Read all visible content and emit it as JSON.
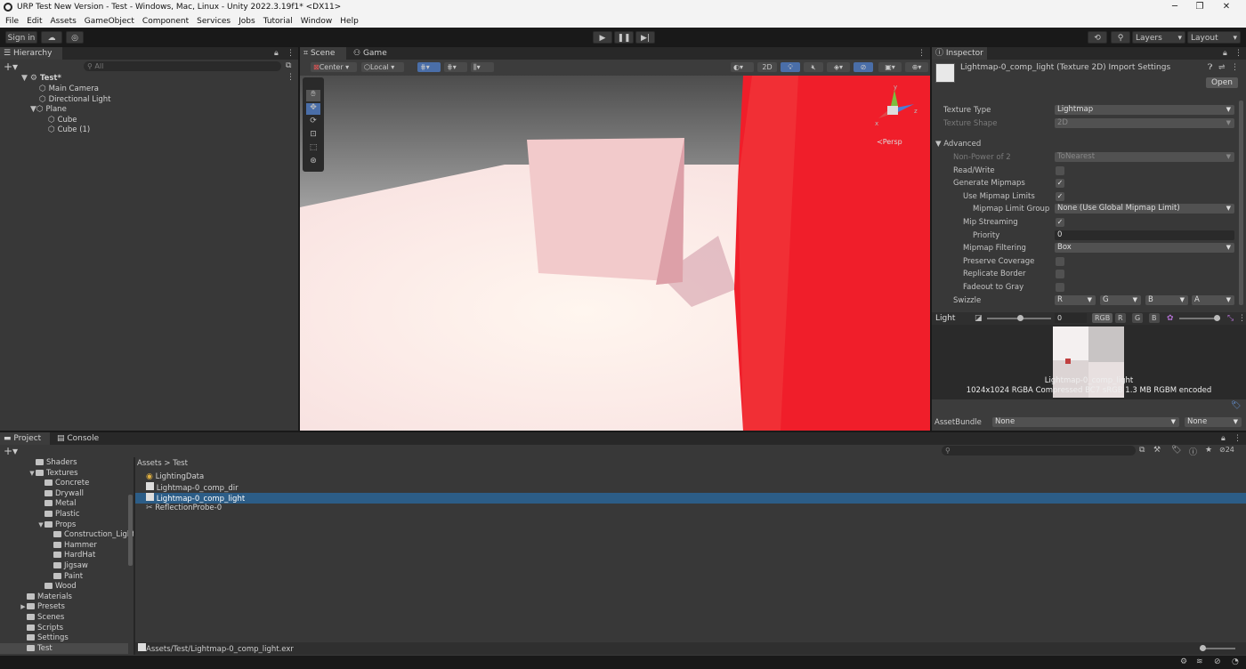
{
  "window": {
    "title": "URP Test New Version - Test - Windows, Mac, Linux - Unity 2022.3.19f1* <DX11>",
    "minimize": "─",
    "maximize": "❐",
    "close": "✕"
  },
  "menu": [
    "File",
    "Edit",
    "Assets",
    "GameObject",
    "Component",
    "Services",
    "Jobs",
    "Tutorial",
    "Window",
    "Help"
  ],
  "toolbar": {
    "sign_in": "Sign in",
    "layers": "Layers",
    "layout": "Layout"
  },
  "hierarchy": {
    "title": "Hierarchy",
    "search_placeholder": "All",
    "scene": "Test*",
    "items": [
      "Main Camera",
      "Directional Light",
      "Plane",
      "Cube",
      "Cube (1)"
    ]
  },
  "scene_view": {
    "tab_scene": "Scene",
    "tab_game": "Game",
    "pivot": "Center",
    "space": "Local",
    "mode_2d": "2D",
    "persp_label": "≺Persp",
    "axis_y": "y",
    "axis_x": "x",
    "axis_z": "z"
  },
  "inspector": {
    "title": "Inspector",
    "asset_title": "Lightmap-0_comp_light (Texture 2D) Import Settings",
    "open_button": "Open",
    "fields": [
      {
        "label": "Texture Type",
        "value": "Lightmap",
        "kind": "dropdown"
      },
      {
        "label": "Texture Shape",
        "value": "2D",
        "kind": "dropdown",
        "dim": true
      }
    ],
    "advanced_label": "Advanced",
    "advanced": [
      {
        "label": "Non-Power of 2",
        "value": "ToNearest",
        "kind": "dropdown",
        "dim": true
      },
      {
        "label": "Read/Write",
        "kind": "check",
        "checked": false
      },
      {
        "label": "Generate Mipmaps",
        "kind": "check",
        "checked": true
      },
      {
        "label": "Use Mipmap Limits",
        "kind": "check",
        "checked": true
      },
      {
        "label": "Mipmap Limit Group",
        "value": "None (Use Global Mipmap Limit)",
        "kind": "dropdown"
      },
      {
        "label": "Mip Streaming",
        "kind": "check",
        "checked": true
      },
      {
        "label": "Priority",
        "value": "0",
        "kind": "text"
      },
      {
        "label": "Mipmap Filtering",
        "value": "Box",
        "kind": "dropdown"
      },
      {
        "label": "Preserve Coverage",
        "kind": "check",
        "checked": false
      },
      {
        "label": "Replicate Border",
        "kind": "check",
        "checked": false
      },
      {
        "label": "Fadeout to Gray",
        "kind": "check",
        "checked": false
      }
    ],
    "swizzle_label": "Swizzle",
    "swizzle": [
      "R",
      "G",
      "B",
      "A"
    ],
    "preview": {
      "title": "Light",
      "mip_value": "0",
      "channels": [
        "RGB",
        "R",
        "G",
        "B"
      ],
      "name": "Lightmap-0_comp_light",
      "info": "1024x1024  RGBA Compressed BC7 sRGB  1.3 MB  RGBM encoded"
    },
    "assetbundle_label": "AssetBundle",
    "assetbundle_name": "None",
    "assetbundle_variant": "None"
  },
  "project": {
    "tab_project": "Project",
    "tab_console": "Console",
    "tree": [
      {
        "label": "Shaders",
        "indent": 1,
        "fold": ""
      },
      {
        "label": "Textures",
        "indent": 1,
        "fold": "▼"
      },
      {
        "label": "Concrete",
        "indent": 2,
        "fold": ""
      },
      {
        "label": "Drywall",
        "indent": 2,
        "fold": ""
      },
      {
        "label": "Metal",
        "indent": 2,
        "fold": ""
      },
      {
        "label": "Plastic",
        "indent": 2,
        "fold": ""
      },
      {
        "label": "Props",
        "indent": 2,
        "fold": "▼"
      },
      {
        "label": "Construction_Light",
        "indent": 3,
        "fold": ""
      },
      {
        "label": "Hammer",
        "indent": 3,
        "fold": ""
      },
      {
        "label": "HardHat",
        "indent": 3,
        "fold": ""
      },
      {
        "label": "Jigsaw",
        "indent": 3,
        "fold": ""
      },
      {
        "label": "Paint",
        "indent": 3,
        "fold": ""
      },
      {
        "label": "Wood",
        "indent": 2,
        "fold": ""
      },
      {
        "label": "Materials",
        "indent": 0,
        "fold": ""
      },
      {
        "label": "Presets",
        "indent": 0,
        "fold": "▶"
      },
      {
        "label": "Scenes",
        "indent": 0,
        "fold": ""
      },
      {
        "label": "Scripts",
        "indent": 0,
        "fold": ""
      },
      {
        "label": "Settings",
        "indent": 0,
        "fold": ""
      },
      {
        "label": "Test",
        "indent": 0,
        "fold": ""
      }
    ],
    "breadcrumb": [
      "Assets",
      ">",
      "Test"
    ],
    "files": [
      "LightingData",
      "Lightmap-0_comp_dir",
      "Lightmap-0_comp_light",
      "ReflectionProbe-0"
    ],
    "selected_file": 2,
    "path": "Assets/Test/Lightmap-0_comp_light.exr",
    "hidden_count": "24"
  },
  "colors": {
    "selection": "#2c5d87",
    "accent": "#4a7bd1",
    "panel": "#383838"
  }
}
